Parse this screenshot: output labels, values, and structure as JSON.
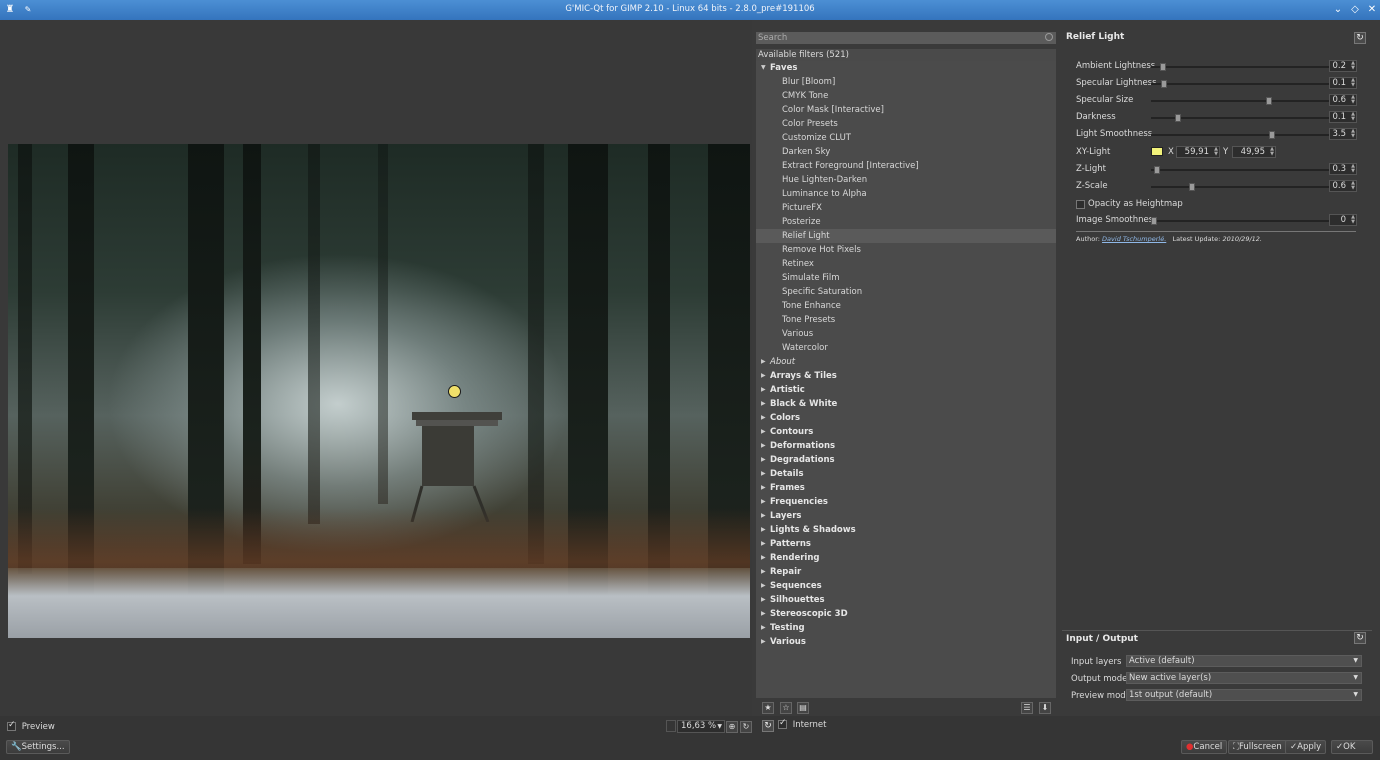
{
  "window": {
    "title": "G'MIC-Qt for GIMP 2.10 - Linux 64 bits - 2.8.0_pre#191106"
  },
  "preview": {
    "checkbox_label": "Preview",
    "checked": true,
    "zoom": "16,63 %",
    "settings_label": "Settings..."
  },
  "filters": {
    "search_placeholder": "Search",
    "header": "Available filters (521)",
    "faves_label": "Faves",
    "faves": [
      "Blur [Bloom]",
      "CMYK Tone",
      "Color Mask [Interactive]",
      "Color Presets",
      "Customize CLUT",
      "Darken Sky",
      "Extract Foreground [Interactive]",
      "Hue Lighten-Darken",
      "Luminance to Alpha",
      "PictureFX",
      "Posterize",
      "Relief Light",
      "Remove Hot Pixels",
      "Retinex",
      "Simulate Film",
      "Specific Saturation",
      "Tone Enhance",
      "Tone Presets",
      "Various",
      "Watercolor"
    ],
    "selected": "Relief Light",
    "about_label": "About",
    "categories": [
      "Arrays & Tiles",
      "Artistic",
      "Black & White",
      "Colors",
      "Contours",
      "Deformations",
      "Degradations",
      "Details",
      "Frames",
      "Frequencies",
      "Layers",
      "Lights & Shadows",
      "Patterns",
      "Rendering",
      "Repair",
      "Sequences",
      "Silhouettes",
      "Stereoscopic 3D",
      "Testing",
      "Various"
    ],
    "internet_label": "Internet",
    "internet_checked": true
  },
  "params": {
    "title": "Relief Light",
    "sliders": [
      {
        "label": "Ambient Lightness",
        "value": "0.2",
        "fraction": 0.05
      },
      {
        "label": "Specular Lightness",
        "value": "0.1",
        "fraction": 0.06
      },
      {
        "label": "Specular Size",
        "value": "0.6",
        "fraction": 0.66
      },
      {
        "label": "Darkness",
        "value": "0.1",
        "fraction": 0.14
      },
      {
        "label": "Light Smoothness",
        "value": "3.5",
        "fraction": 0.68
      }
    ],
    "xy": {
      "label": "XY-Light",
      "x_label": "X",
      "x_value": "59,91",
      "y_label": "Y",
      "y_value": "49,95",
      "swatch": "#f2f27a"
    },
    "sliders2": [
      {
        "label": "Z-Light",
        "value": "0.3",
        "fraction": 0.02
      },
      {
        "label": "Z-Scale",
        "value": "0.6",
        "fraction": 0.22
      }
    ],
    "opacity_label": "Opacity as Heightmap",
    "opacity_checked": false,
    "image_smoothness": {
      "label": "Image Smoothness",
      "value": "0",
      "fraction": 0.0
    },
    "author_prefix": "Author:",
    "author": "David Tschumperlé.",
    "update_prefix": "Latest Update:",
    "update": "2010/29/12."
  },
  "io": {
    "title": "Input / Output",
    "rows": [
      {
        "label": "Input layers",
        "value": "Active (default)"
      },
      {
        "label": "Output mode",
        "value": "New active layer(s)"
      },
      {
        "label": "Preview mode",
        "value": "1st output (default)"
      }
    ]
  },
  "buttons": {
    "cancel": "Cancel",
    "fullscreen": "Fullscreen",
    "apply": "Apply",
    "ok": "OK"
  },
  "colors": {
    "titlebar": "#3f82c8",
    "background": "#3a3a3a",
    "light_handle": "#f0e06a"
  }
}
